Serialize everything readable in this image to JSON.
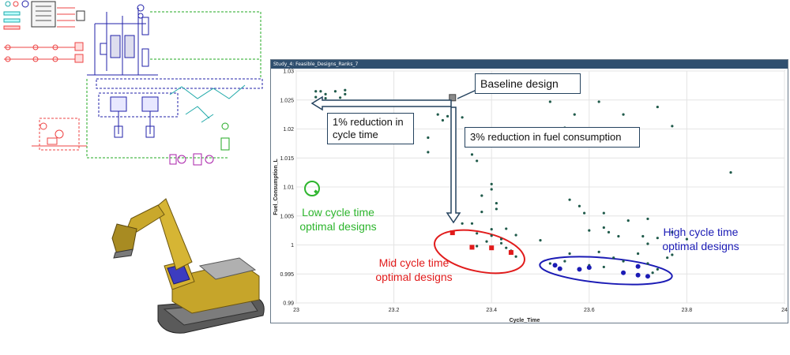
{
  "window": {
    "title": "Study_4: Feasible_Designs_Ranks_7"
  },
  "annotations": {
    "baseline": "Baseline design",
    "cycle_reduction": "1% reduction in cycle time",
    "fuel_reduction": "3% reduction in fuel consumption",
    "low": "Low cycle time optimal designs",
    "mid": "Mid cycle time optimal designs",
    "high": "High cycle time optimal designs"
  },
  "colors": {
    "low": "#2db52d",
    "mid": "#e11b1b",
    "high": "#1b1bb5",
    "points": "#1f5a4a",
    "arrow": "#24425e"
  },
  "icons": {
    "schematic": "hydraulic-system-schematic",
    "excavator": "excavator-3d-model"
  },
  "chart_data": {
    "type": "scatter",
    "xlabel": "Cycle_Time",
    "ylabel": "Fuel_Consumption_L",
    "xlim": [
      23,
      24
    ],
    "ylim": [
      0.99,
      1.03
    ],
    "xticks": [
      "23",
      "23.2",
      "23.4",
      "23.6",
      "23.8",
      "24"
    ],
    "yticks": [
      "0.99",
      "0.995",
      "1",
      "1.005",
      "1.01",
      "1.015",
      "1.02",
      "1.025",
      "1.03"
    ],
    "grid": true,
    "baseline": {
      "x": 23.32,
      "y": 1.0254
    },
    "series": [
      {
        "role": "feasible",
        "points": [
          [
            23.04,
            1.0265
          ],
          [
            23.05,
            1.0265
          ],
          [
            23.06,
            1.026
          ],
          [
            23.08,
            1.0265
          ],
          [
            23.1,
            1.0267
          ],
          [
            23.04,
            1.0255
          ],
          [
            23.06,
            1.0253
          ],
          [
            23.09,
            1.0254
          ],
          [
            23.1,
            1.026
          ],
          [
            23.29,
            1.0225
          ],
          [
            23.31,
            1.0222
          ],
          [
            23.27,
            1.0185
          ],
          [
            23.27,
            1.016
          ],
          [
            23.3,
            1.0215
          ],
          [
            23.34,
            1.022
          ],
          [
            23.36,
            1.0156
          ],
          [
            23.37,
            1.0145
          ],
          [
            23.4,
            1.0105
          ],
          [
            23.4,
            1.0096
          ],
          [
            23.38,
            1.0085
          ],
          [
            23.41,
            1.0072
          ],
          [
            23.41,
            1.0062
          ],
          [
            23.38,
            1.0057
          ],
          [
            23.36,
            1.0037
          ],
          [
            23.43,
            1.0028
          ],
          [
            23.4,
            1.0027
          ],
          [
            23.45,
            1.0017
          ],
          [
            23.42,
            1.001
          ],
          [
            23.39,
            1.0006
          ],
          [
            23.37,
            1.002
          ],
          [
            23.43,
            0.9995
          ],
          [
            23.44,
            0.999
          ],
          [
            23.45,
            0.998
          ],
          [
            23.37,
            0.9998
          ],
          [
            23.34,
            1.0037
          ],
          [
            23.4,
            1.0016
          ],
          [
            23.42,
            1.0003
          ],
          [
            23.52,
            1.0247
          ],
          [
            23.57,
            1.0225
          ],
          [
            23.62,
            1.0247
          ],
          [
            23.67,
            1.0225
          ],
          [
            23.74,
            1.0238
          ],
          [
            23.55,
            1.0202
          ],
          [
            23.77,
            1.0205
          ],
          [
            23.89,
            1.0125
          ],
          [
            23.58,
            1.0067
          ],
          [
            23.56,
            1.0078
          ],
          [
            23.59,
            1.0055
          ],
          [
            23.63,
            1.0055
          ],
          [
            23.68,
            1.0042
          ],
          [
            23.72,
            1.0045
          ],
          [
            23.6,
            1.0025
          ],
          [
            23.63,
            1.003
          ],
          [
            23.64,
            1.0022
          ],
          [
            23.66,
            1.0015
          ],
          [
            23.71,
            1.0015
          ],
          [
            23.72,
            1.0002
          ],
          [
            23.77,
            1.0022
          ],
          [
            23.74,
            1.0012
          ],
          [
            23.8,
            1.001
          ],
          [
            23.5,
            1.0008
          ],
          [
            23.56,
            0.9985
          ],
          [
            23.62,
            0.9988
          ],
          [
            23.65,
            0.9978
          ],
          [
            23.7,
            0.9985
          ],
          [
            23.67,
            0.9972
          ],
          [
            23.72,
            0.9968
          ],
          [
            23.6,
            0.9965
          ],
          [
            23.63,
            0.9962
          ],
          [
            23.55,
            0.9972
          ],
          [
            23.52,
            0.9968
          ],
          [
            23.76,
            0.9978
          ],
          [
            23.73,
            0.9952
          ],
          [
            23.77,
            0.9983
          ],
          [
            23.74,
            0.9958
          ]
        ]
      },
      {
        "role": "low-optimal",
        "points": [
          [
            23.04,
            1.0092
          ]
        ]
      },
      {
        "role": "mid-optimal",
        "points": [
          [
            23.32,
            1.0021
          ],
          [
            23.36,
            0.9996
          ],
          [
            23.4,
            0.9995
          ],
          [
            23.44,
            0.9987
          ]
        ]
      },
      {
        "role": "high-optimal",
        "points": [
          [
            23.53,
            0.9965
          ],
          [
            23.54,
            0.9959
          ],
          [
            23.58,
            0.9958
          ],
          [
            23.6,
            0.9961
          ],
          [
            23.67,
            0.9952
          ],
          [
            23.7,
            0.9948
          ],
          [
            23.72,
            0.9946
          ],
          [
            23.7,
            0.9963
          ]
        ]
      }
    ]
  }
}
